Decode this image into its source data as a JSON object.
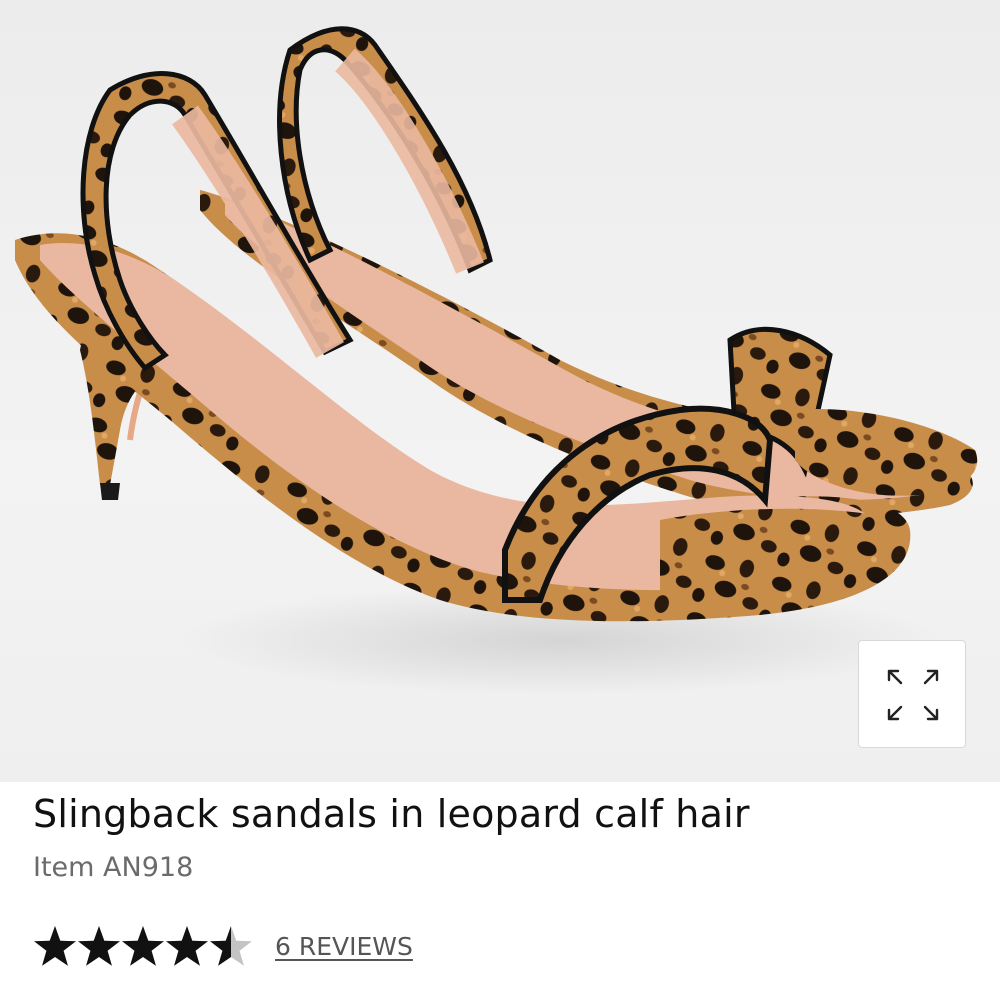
{
  "product": {
    "title": "Slingback sandals in leopard calf hair",
    "item_number": "Item AN918",
    "rating": 4.5,
    "rating_max": 5,
    "reviews_label": "6 REVIEWS"
  },
  "image": {
    "subject": "leopard-print-slingback-sandals",
    "expand_icon": "expand-arrows-icon"
  },
  "colors": {
    "leopard_base": "#c98d4a",
    "leopard_spot": "#1e140c",
    "lining": "#eab8a0",
    "star": "#111111",
    "star_empty": "#c4c4c4"
  }
}
